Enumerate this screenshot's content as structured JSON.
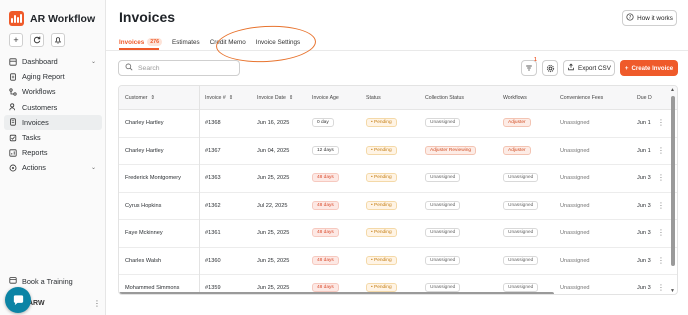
{
  "app": {
    "name": "AR Workflow",
    "brand_color": "#ef5a2a"
  },
  "sidebar": {
    "top_icons": [
      "add-icon",
      "refresh-icon",
      "bell-icon"
    ],
    "items": [
      {
        "label": "Dashboard",
        "icon": "grid-icon",
        "has_chevron": true
      },
      {
        "label": "Aging Report",
        "icon": "report-icon"
      },
      {
        "label": "Workflows",
        "icon": "workflow-icon"
      },
      {
        "label": "Customers",
        "icon": "users-icon"
      },
      {
        "label": "Invoices",
        "icon": "invoice-icon",
        "active": true
      },
      {
        "label": "Tasks",
        "icon": "tasks-icon"
      },
      {
        "label": "Reports",
        "icon": "reports-icon"
      },
      {
        "label": "Actions",
        "icon": "actions-icon",
        "has_chevron": true
      }
    ],
    "book_training": "Book a Training",
    "user_initials": "ARW"
  },
  "page": {
    "title": "Invoices",
    "how_it_works": "How it works",
    "tabs": [
      {
        "label": "Invoices",
        "count": "276",
        "active": true
      },
      {
        "label": "Estimates"
      },
      {
        "label": "Credit Memo"
      },
      {
        "label": "Invoice Settings"
      }
    ],
    "search_placeholder": "Search",
    "filter_badge": "1",
    "export_label": "Export CSV",
    "create_label": "Create Invoice"
  },
  "table": {
    "columns": [
      "Customer",
      "Invoice #",
      "Invoice Date",
      "Invoice Age",
      "Status",
      "Collection Status",
      "Workflows",
      "Convenience Fees",
      "Due D"
    ],
    "rows": [
      {
        "customer": "Charley Hartley",
        "invoice": "#1368",
        "date": "Jun 16, 2025",
        "age": "0 day",
        "overdue": false,
        "status": "Pending",
        "collection": "Unassigned",
        "workflow": "Adjuster",
        "fees": "Unassigned",
        "due": "Jun 1"
      },
      {
        "customer": "Charley Hartley",
        "invoice": "#1367",
        "date": "Jun 04, 2025",
        "age": "12 days",
        "overdue": false,
        "status": "Pending",
        "collection": "Adjuster Reviewing",
        "workflow": "Adjuster",
        "fees": "Unassigned",
        "due": "Jun 1"
      },
      {
        "customer": "Frederick Montgomery",
        "invoice": "#1363",
        "date": "Jun 25, 2025",
        "age": "48 days",
        "overdue": true,
        "status": "Pending",
        "collection": "Unassigned",
        "workflow": "Unassigned",
        "fees": "Unassigned",
        "due": "Jun 3"
      },
      {
        "customer": "Cyrus Hopkins",
        "invoice": "#1362",
        "date": "Jul 22, 2025",
        "age": "48 days",
        "overdue": true,
        "status": "Pending",
        "collection": "Unassigned",
        "workflow": "Unassigned",
        "fees": "Unassigned",
        "due": "Jun 3"
      },
      {
        "customer": "Faye Mckinney",
        "invoice": "#1361",
        "date": "Jun 25, 2025",
        "age": "48 days",
        "overdue": true,
        "status": "Pending",
        "collection": "Unassigned",
        "workflow": "Unassigned",
        "fees": "Unassigned",
        "due": "Jun 3"
      },
      {
        "customer": "Charles Walsh",
        "invoice": "#1360",
        "date": "Jun 25, 2025",
        "age": "48 days",
        "overdue": true,
        "status": "Pending",
        "collection": "Unassigned",
        "workflow": "Unassigned",
        "fees": "Unassigned",
        "due": "Jun 3"
      },
      {
        "customer": "Mohammed Simmons",
        "invoice": "#1359",
        "date": "Jun 25, 2025",
        "age": "48 days",
        "overdue": true,
        "status": "Pending",
        "collection": "Unassigned",
        "workflow": "Unassigned",
        "fees": "Unassigned",
        "due": "Jun 3"
      }
    ]
  }
}
